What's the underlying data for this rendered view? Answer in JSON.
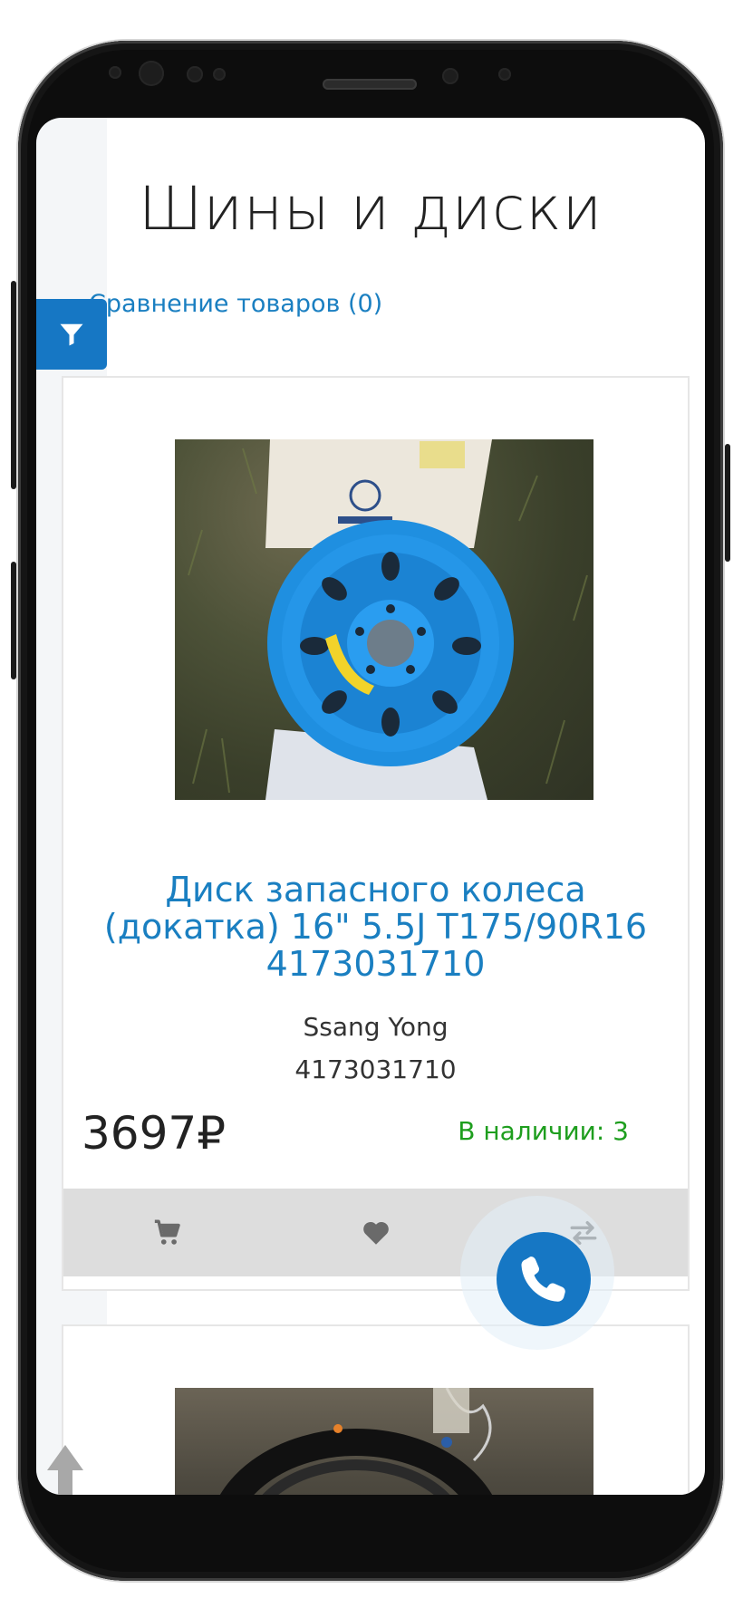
{
  "page": {
    "title": "Шины и диски",
    "compare_link": "Сравнение товаров (0)"
  },
  "product": {
    "title": "Диск запасного колеса (докатка) 16\" 5.5J T175/90R16 4173031710",
    "brand": "Ssang Yong",
    "sku": "4173031710",
    "price": "3697₽",
    "stock": "В наличии: 3"
  },
  "icons": {
    "filter": "filter-icon",
    "cart": "cart-icon",
    "wishlist": "heart-icon",
    "compare": "compare-arrows-icon",
    "call": "phone-icon",
    "scroll_up": "arrow-up-icon"
  },
  "colors": {
    "accent": "#1677c4",
    "link": "#1a7fc1",
    "in_stock": "#1e9e1e",
    "action_bar": "#dddddd"
  }
}
